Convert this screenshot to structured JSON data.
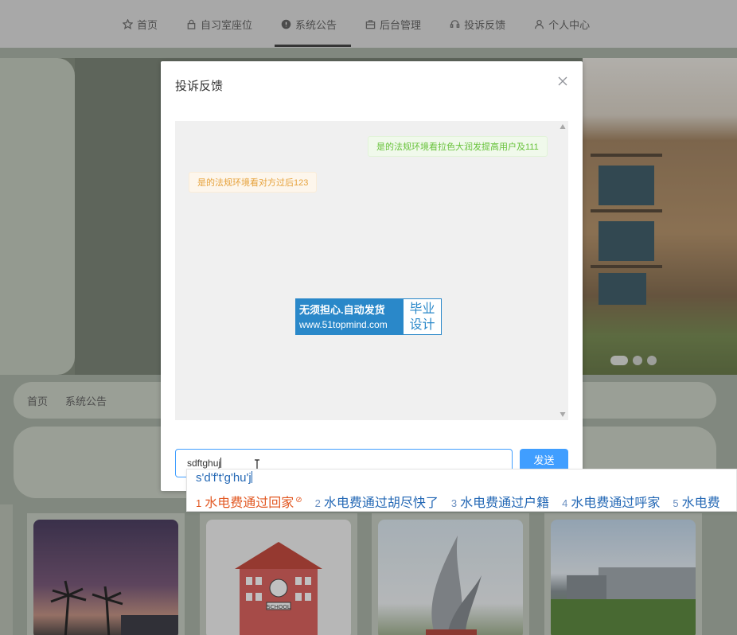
{
  "nav": {
    "items": [
      {
        "label": "首页",
        "icon": "star-icon"
      },
      {
        "label": "自习室座位",
        "icon": "lock-icon"
      },
      {
        "label": "系统公告",
        "icon": "alert-circle-icon",
        "active": true
      },
      {
        "label": "后台管理",
        "icon": "briefcase-icon"
      },
      {
        "label": "投诉反馈",
        "icon": "headset-icon"
      },
      {
        "label": "个人中心",
        "icon": "user-icon"
      }
    ]
  },
  "breadcrumb": {
    "home": "首页",
    "current": "系统公告"
  },
  "carousel": {
    "slide_count": 3,
    "active_slide": 1
  },
  "dialog": {
    "title": "投诉反馈",
    "messages": [
      {
        "side": "right",
        "text": "是的法规环境看拉色大润发提高用户及111"
      },
      {
        "side": "left",
        "text": "是的法规环境看对方过后123"
      }
    ],
    "watermark": {
      "line1": "无须担心.自动发货",
      "line2": "www.51topmind.com",
      "side_top": "毕业",
      "side_bottom": "设计"
    },
    "input_value": "sdftghuj",
    "send_label": "发送"
  },
  "ime": {
    "composition": "s'd'f't'g'hu'j",
    "candidates": [
      {
        "num": "1",
        "text": "水电费通过回家"
      },
      {
        "num": "2",
        "text": "水电费通过胡尽快了"
      },
      {
        "num": "3",
        "text": "水电费通过户籍"
      },
      {
        "num": "4",
        "text": "水电费通过呼家"
      },
      {
        "num": "5",
        "text": "水电费"
      }
    ]
  },
  "colors": {
    "primary": "#409eff",
    "success_text": "#67c23a",
    "warning_text": "#e6a23c"
  }
}
